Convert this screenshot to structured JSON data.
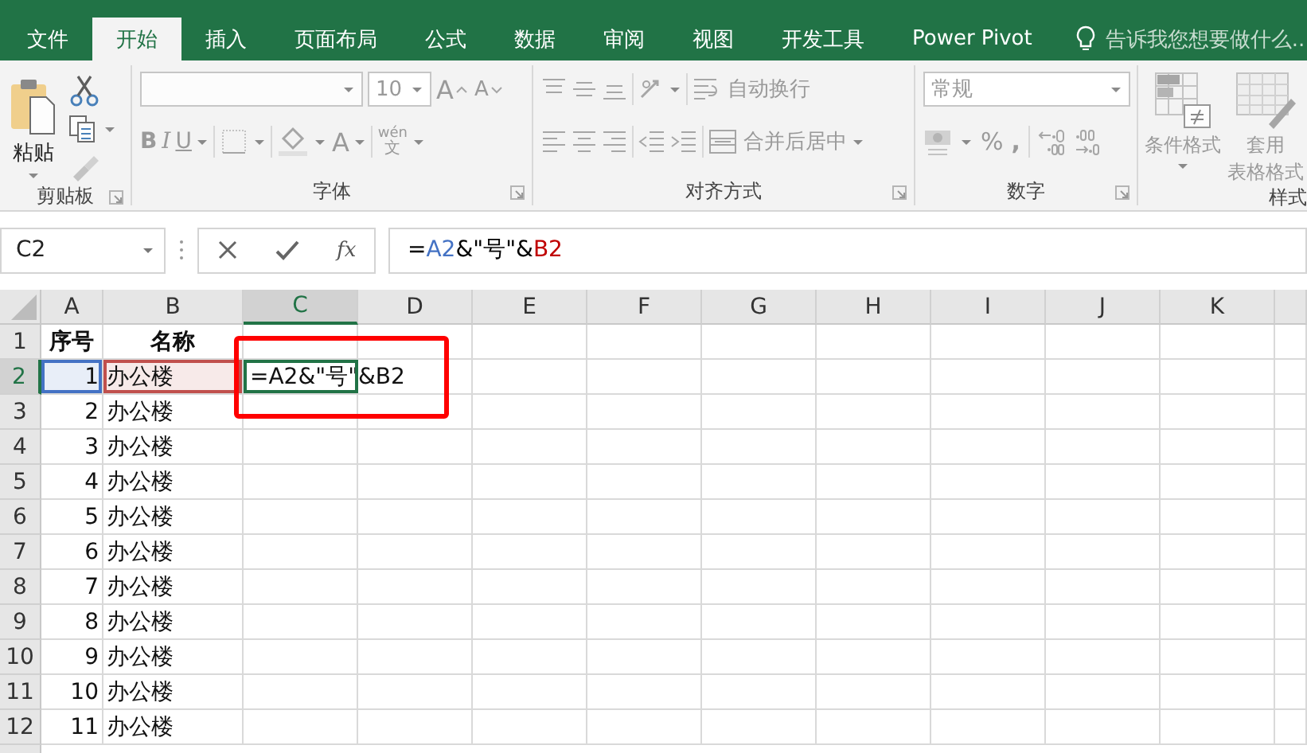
{
  "tabs": [
    {
      "label": "文件",
      "selected": false
    },
    {
      "label": "开始",
      "selected": true
    },
    {
      "label": "插入",
      "selected": false
    },
    {
      "label": "页面布局",
      "selected": false
    },
    {
      "label": "公式",
      "selected": false
    },
    {
      "label": "数据",
      "selected": false
    },
    {
      "label": "审阅",
      "selected": false
    },
    {
      "label": "视图",
      "selected": false
    },
    {
      "label": "开发工具",
      "selected": false
    },
    {
      "label": "Power Pivot",
      "selected": false
    }
  ],
  "tell_me": {
    "placeholder": "告诉我您想要做什么..."
  },
  "ribbon": {
    "disabled": true,
    "groups": [
      {
        "kind": "clipboard",
        "label": "剪贴板",
        "launcher": true,
        "paste": "粘贴"
      },
      {
        "kind": "font",
        "label": "字体",
        "launcher": true,
        "font_size": "10",
        "grow": "A",
        "shrink": "A",
        "bold": "B",
        "italic": "I",
        "underline": "U",
        "font_color": "A",
        "phonetic_top": "wén",
        "phonetic_bottom": "文"
      },
      {
        "kind": "alignment",
        "label": "对齐方式",
        "launcher": true,
        "wrap": "自动换行",
        "merge": "合并后居中"
      },
      {
        "kind": "number",
        "label": "数字",
        "launcher": true,
        "format": "常规",
        "percent": "%",
        "comma": ","
      },
      {
        "kind": "styles",
        "label": "样式",
        "launcher": false,
        "conditional": "条件格式",
        "table_line1": "套用",
        "table_line2": "表格格式"
      }
    ]
  },
  "formula_bar": {
    "name_box": "C2",
    "fx": "fx",
    "segments": [
      {
        "text": "=",
        "color": "#000000"
      },
      {
        "text": "A2",
        "color": "#4472c4"
      },
      {
        "text": "&\"号\"&",
        "color": "#000000"
      },
      {
        "text": "B2",
        "color": "#c00000"
      }
    ]
  },
  "sheet": {
    "columns": [
      {
        "label": "A",
        "selected": false
      },
      {
        "label": "B",
        "selected": false
      },
      {
        "label": "C",
        "selected": true
      },
      {
        "label": "D",
        "selected": false
      },
      {
        "label": "E",
        "selected": false
      },
      {
        "label": "F",
        "selected": false
      },
      {
        "label": "G",
        "selected": false
      },
      {
        "label": "H",
        "selected": false
      },
      {
        "label": "I",
        "selected": false
      },
      {
        "label": "J",
        "selected": false
      },
      {
        "label": "K",
        "selected": false
      }
    ],
    "rows": [
      {
        "header": "1",
        "selected": false,
        "cells": [
          {
            "text": "序号",
            "kind": "heading"
          },
          {
            "text": "名称",
            "kind": "heading"
          }
        ]
      },
      {
        "header": "2",
        "selected": true,
        "cells": [
          {
            "text": "1",
            "kind": "number",
            "color": "#4472c4"
          },
          {
            "text": "办公楼",
            "kind": "text",
            "color": "#c0504d"
          },
          {
            "text": "=A2&\"号\"&B2",
            "kind": "text",
            "active": true
          }
        ]
      },
      {
        "header": "3",
        "selected": false,
        "cells": [
          {
            "text": "2",
            "kind": "number"
          },
          {
            "text": "办公楼",
            "kind": "text"
          }
        ]
      },
      {
        "header": "4",
        "selected": false,
        "cells": [
          {
            "text": "3",
            "kind": "number"
          },
          {
            "text": "办公楼",
            "kind": "text"
          }
        ]
      },
      {
        "header": "5",
        "selected": false,
        "cells": [
          {
            "text": "4",
            "kind": "number"
          },
          {
            "text": "办公楼",
            "kind": "text"
          }
        ]
      },
      {
        "header": "6",
        "selected": false,
        "cells": [
          {
            "text": "5",
            "kind": "number"
          },
          {
            "text": "办公楼",
            "kind": "text"
          }
        ]
      },
      {
        "header": "7",
        "selected": false,
        "cells": [
          {
            "text": "6",
            "kind": "number"
          },
          {
            "text": "办公楼",
            "kind": "text"
          }
        ]
      },
      {
        "header": "8",
        "selected": false,
        "cells": [
          {
            "text": "7",
            "kind": "number"
          },
          {
            "text": "办公楼",
            "kind": "text"
          }
        ]
      },
      {
        "header": "9",
        "selected": false,
        "cells": [
          {
            "text": "8",
            "kind": "number"
          },
          {
            "text": "办公楼",
            "kind": "text"
          }
        ]
      },
      {
        "header": "10",
        "selected": false,
        "cells": [
          {
            "text": "9",
            "kind": "number"
          },
          {
            "text": "办公楼",
            "kind": "text"
          }
        ]
      },
      {
        "header": "11",
        "selected": false,
        "cells": [
          {
            "text": "10",
            "kind": "number"
          },
          {
            "text": "办公楼",
            "kind": "text"
          }
        ]
      },
      {
        "header": "12",
        "selected": false,
        "cells": [
          {
            "text": "11",
            "kind": "number"
          },
          {
            "text": "办公楼",
            "kind": "text"
          }
        ]
      }
    ],
    "annotation": {
      "kind": "highlight-box",
      "color": "#ff0000"
    }
  }
}
